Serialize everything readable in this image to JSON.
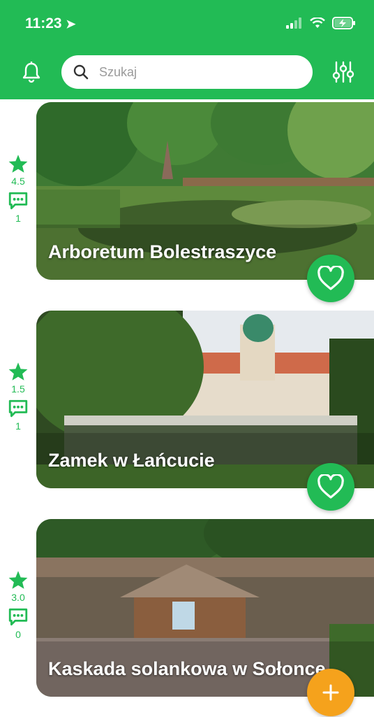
{
  "status": {
    "time": "11:23"
  },
  "search": {
    "placeholder": "Szukaj"
  },
  "places": [
    {
      "title": "Arboretum Bolestraszyce",
      "rating": "4.5",
      "comments": "1"
    },
    {
      "title": "Zamek w Łańcucie",
      "rating": "1.5",
      "comments": "1"
    },
    {
      "title": "Kaskada solankowa w Sołonce",
      "rating": "3.0",
      "comments": "0"
    }
  ],
  "colors": {
    "primary": "#22bb55",
    "accent": "#f5a21c"
  }
}
